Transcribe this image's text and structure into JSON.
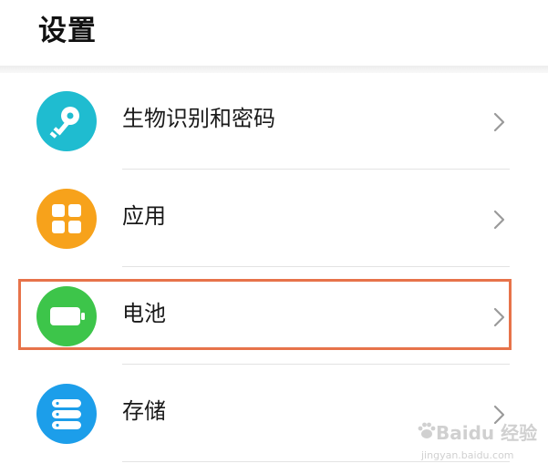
{
  "header": {
    "title": "设置"
  },
  "settings": [
    {
      "label": "生物识别和密码",
      "icon": "key-icon",
      "color": "#1fbcd0"
    },
    {
      "label": "应用",
      "icon": "apps-grid-icon",
      "color": "#f7a21b"
    },
    {
      "label": "电池",
      "icon": "battery-icon",
      "color": "#3dc54a"
    },
    {
      "label": "存储",
      "icon": "storage-icon",
      "color": "#1c9eea"
    }
  ],
  "highlight": {
    "target": "电池",
    "color": "#e7734a"
  },
  "watermark": {
    "text": "Baidu 经验",
    "url": "jingyan.baidu.com"
  }
}
